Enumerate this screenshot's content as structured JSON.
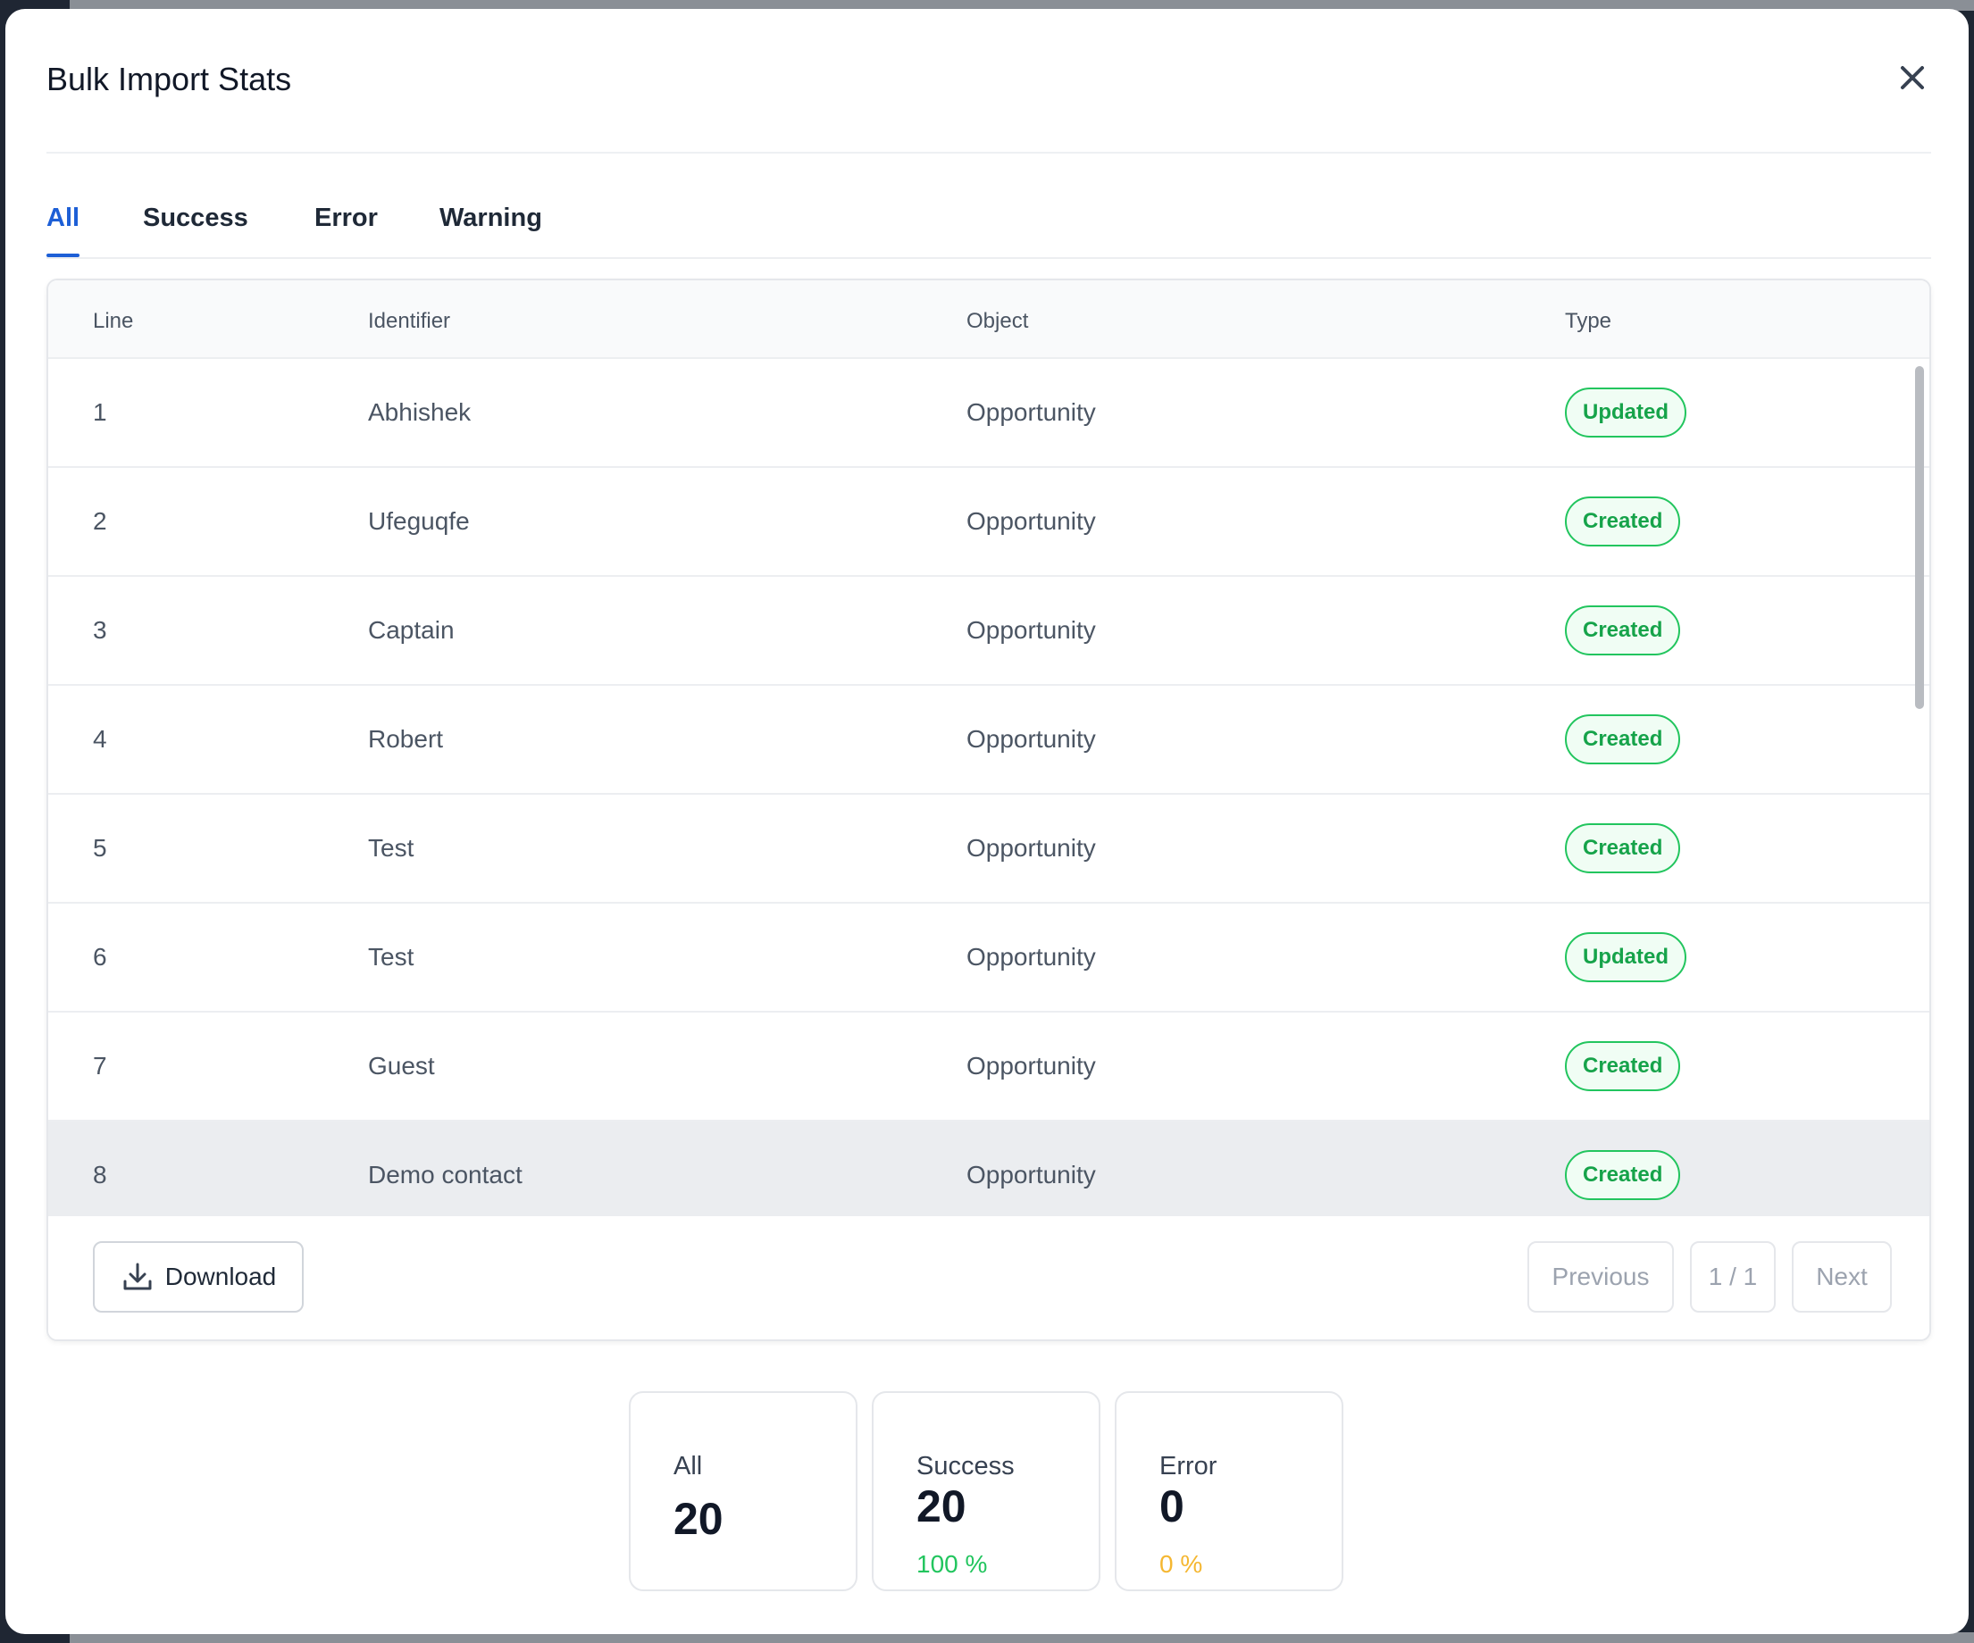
{
  "modal": {
    "title": "Bulk Import Stats"
  },
  "tabs": [
    {
      "label": "All",
      "active": true
    },
    {
      "label": "Success",
      "active": false
    },
    {
      "label": "Error",
      "active": false
    },
    {
      "label": "Warning",
      "active": false
    }
  ],
  "table": {
    "columns": {
      "line": "Line",
      "identifier": "Identifier",
      "object": "Object",
      "type": "Type"
    },
    "rows": [
      {
        "line": "1",
        "identifier": "Abhishek",
        "object": "Opportunity",
        "type": "Updated"
      },
      {
        "line": "2",
        "identifier": "Ufeguqfe",
        "object": "Opportunity",
        "type": "Created"
      },
      {
        "line": "3",
        "identifier": "Captain",
        "object": "Opportunity",
        "type": "Created"
      },
      {
        "line": "4",
        "identifier": "Robert",
        "object": "Opportunity",
        "type": "Created"
      },
      {
        "line": "5",
        "identifier": "Test",
        "object": "Opportunity",
        "type": "Created"
      },
      {
        "line": "6",
        "identifier": "Test",
        "object": "Opportunity",
        "type": "Updated"
      },
      {
        "line": "7",
        "identifier": "Guest",
        "object": "Opportunity",
        "type": "Created"
      },
      {
        "line": "8",
        "identifier": "Demo contact",
        "object": "Opportunity",
        "type": "Created"
      }
    ]
  },
  "footer": {
    "download_label": "Download",
    "previous_label": "Previous",
    "page_indicator": "1 / 1",
    "next_label": "Next"
  },
  "stats": {
    "all": {
      "label": "All",
      "value": "20"
    },
    "success": {
      "label": "Success",
      "value": "20",
      "percent": "100 %"
    },
    "error": {
      "label": "Error",
      "value": "0",
      "percent": "0 %"
    }
  },
  "colors": {
    "accent": "#1d5fd6",
    "success": "#22c55e",
    "warning": "#f5b731"
  },
  "icons": {
    "close": "close-icon",
    "download": "download-icon"
  }
}
